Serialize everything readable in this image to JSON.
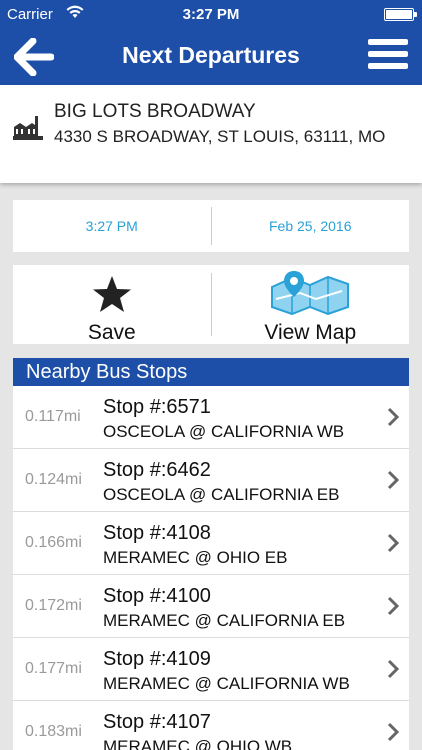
{
  "status": {
    "carrier": "Carrier",
    "time": "3:27 PM"
  },
  "nav": {
    "title": "Next Departures"
  },
  "location": {
    "name": "BIG LOTS BROADWAY",
    "address": "4330 S BROADWAY, ST LOUIS, 63111, MO"
  },
  "datetime": {
    "time": "3:27 PM",
    "date": "Feb 25, 2016"
  },
  "actions": {
    "save_label": "Save",
    "map_label": "View Map"
  },
  "stops": {
    "header": "Nearby Bus Stops",
    "items": [
      {
        "distance": "0.117mi",
        "stop": "Stop #:6571",
        "name": "OSCEOLA @ CALIFORNIA WB"
      },
      {
        "distance": "0.124mi",
        "stop": "Stop #:6462",
        "name": "OSCEOLA @ CALIFORNIA EB"
      },
      {
        "distance": "0.166mi",
        "stop": "Stop #:4108",
        "name": "MERAMEC @ OHIO EB"
      },
      {
        "distance": "0.172mi",
        "stop": "Stop #:4100",
        "name": "MERAMEC @ CALIFORNIA EB"
      },
      {
        "distance": "0.177mi",
        "stop": "Stop #:4109",
        "name": "MERAMEC @ CALIFORNIA WB"
      },
      {
        "distance": "0.183mi",
        "stop": "Stop #:4107",
        "name": "MERAMEC @ OHIO WB"
      }
    ]
  },
  "colors": {
    "brand_blue": "#1d4fa8",
    "accent_cyan": "#2aa1d7"
  }
}
